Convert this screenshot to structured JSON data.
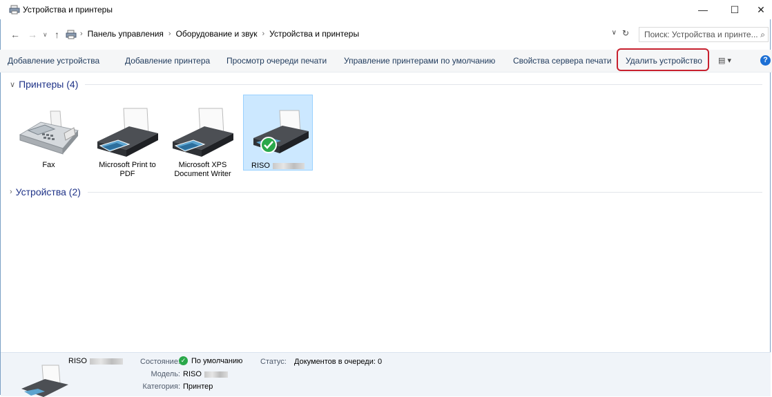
{
  "window": {
    "title": "Устройства и принтеры",
    "controls": {
      "minimize": "—",
      "maximize": "☐",
      "close": "✕"
    }
  },
  "address": {
    "crumbs": [
      "Панель управления",
      "Оборудование и звук",
      "Устройства и принтеры"
    ],
    "search_placeholder": "Поиск: Устройства и принте..."
  },
  "commands": {
    "add_device": "Добавление устройства",
    "add_printer": "Добавление принтера",
    "view_queue": "Просмотр очереди печати",
    "manage_default": "Управление принтерами по умолчанию",
    "server_props": "Свойства сервера печати",
    "remove_device": "Удалить устройство"
  },
  "groups": {
    "printers": "Принтеры (4)",
    "devices": "Устройства (2)"
  },
  "printers": [
    {
      "line1": "Fax",
      "line2": ""
    },
    {
      "line1": "Microsoft Print to",
      "line2": "PDF"
    },
    {
      "line1": "Microsoft XPS",
      "line2": "Document Writer"
    },
    {
      "line1": "RISO",
      "line2": ""
    }
  ],
  "details": {
    "name": "RISO",
    "state_label": "Состояние:",
    "state_value": "По умолчанию",
    "status_label": "Статус:",
    "status_value": "Документов в очереди: 0",
    "model_label": "Модель:",
    "model_value": "RISO",
    "category_label": "Категория:",
    "category_value": "Принтер"
  },
  "colors": {
    "accent": "#1e395b",
    "group_header": "#1e3287",
    "selection": "#cce8ff",
    "highlight_box": "#c8202e",
    "default_check": "#2aa84a"
  }
}
